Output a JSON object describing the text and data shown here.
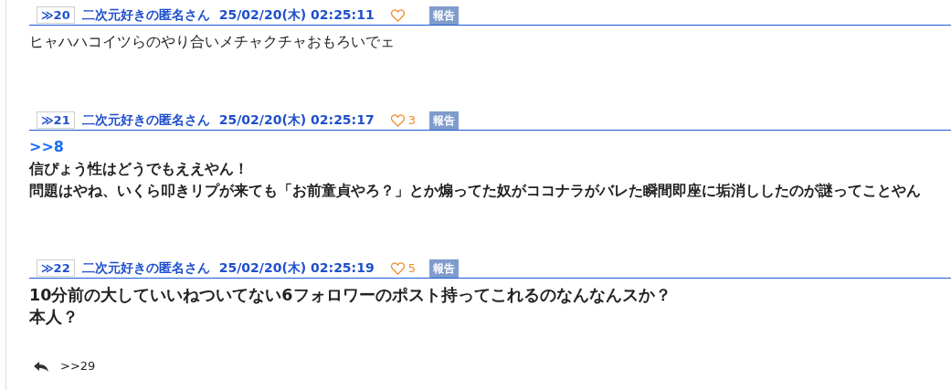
{
  "posts": [
    {
      "number": "≫20",
      "author": "二次元好きの匿名さん",
      "date": "25/02/20(木) 02:25:11",
      "report": "報告",
      "kind": "plain",
      "lines": [
        "ヒャハハコイツらのやり合いメチャクチャおもろいでェ"
      ]
    },
    {
      "number": "≫21",
      "author": "二次元好きの匿名さん",
      "date": "25/02/20(木) 02:25:17",
      "likes": "3",
      "report": "報告",
      "kind": "bold",
      "anchor": ">>8",
      "lines": [
        "信ぴょう性はどうでもええやん！",
        "問題はやね、いくら叩きリプが来ても「お前童貞やろ？」とか煽ってた奴がココナラがバレた瞬間即座に垢消ししたのが謎ってことやん"
      ]
    },
    {
      "number": "≫22",
      "author": "二次元好きの匿名さん",
      "date": "25/02/20(木) 02:25:19",
      "likes": "5",
      "report": "報告",
      "kind": "large",
      "lines": [
        "10分前の大していいねついてない6フォロワーのポスト持ってこれるのなんなんスか？",
        "本人？"
      ]
    }
  ],
  "replies": {
    "link": ">>29"
  }
}
